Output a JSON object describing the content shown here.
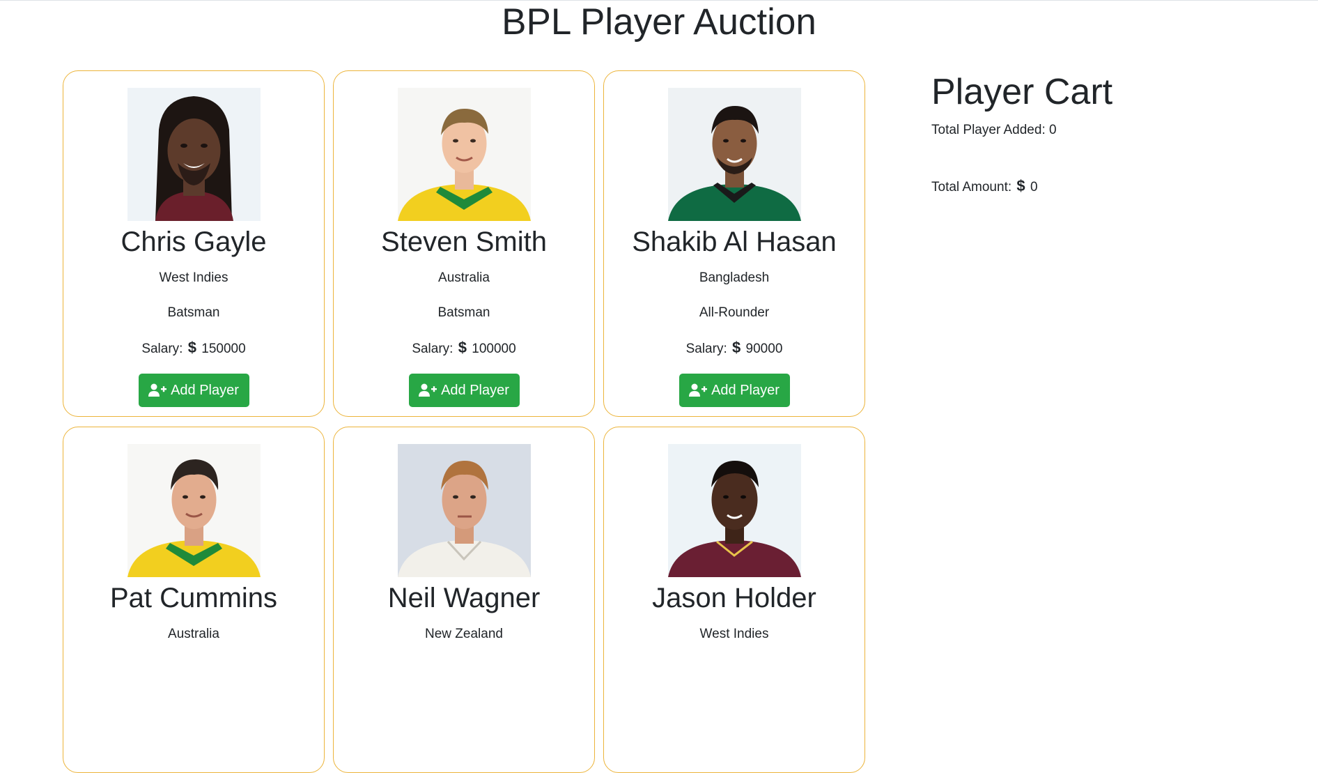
{
  "page": {
    "title": "BPL Player Auction"
  },
  "players": [
    {
      "name": "Chris Gayle",
      "country": "West Indies",
      "role": "Batsman",
      "salary_label": "Salary:",
      "salary": "150000",
      "button_label": "Add Player",
      "photo_alt": "Chris Gayle"
    },
    {
      "name": "Steven Smith",
      "country": "Australia",
      "role": "Batsman",
      "salary_label": "Salary:",
      "salary": "100000",
      "button_label": "Add Player",
      "photo_alt": "Steven Smith"
    },
    {
      "name": "Shakib Al Hasan",
      "country": "Bangladesh",
      "role": "All-Rounder",
      "salary_label": "Salary:",
      "salary": "90000",
      "button_label": "Add Player",
      "photo_alt": "Shakib Al Hasan"
    },
    {
      "name": "Pat Cummins",
      "country": "Australia",
      "role": "",
      "salary_label": "",
      "salary": "",
      "button_label": "",
      "photo_alt": "Pat Cummins"
    },
    {
      "name": "Neil Wagner",
      "country": "New Zealand",
      "role": "",
      "salary_label": "",
      "salary": "",
      "button_label": "",
      "photo_alt": "Neil Wagner"
    },
    {
      "name": "Jason Holder",
      "country": "West Indies",
      "role": "",
      "salary_label": "",
      "salary": "",
      "button_label": "",
      "photo_alt": "Jason Holder"
    }
  ],
  "cart": {
    "title": "Player Cart",
    "added_label": "Total Player Added:",
    "added_count": "0",
    "amount_label": "Total Amount:",
    "amount": "0"
  },
  "icons": {
    "currency": "dollar-icon",
    "add_player": "user-plus-icon"
  },
  "colors": {
    "card_border": "#ecb43a",
    "button_bg": "#28a745",
    "button_text": "#ffffff",
    "text": "#212529"
  }
}
